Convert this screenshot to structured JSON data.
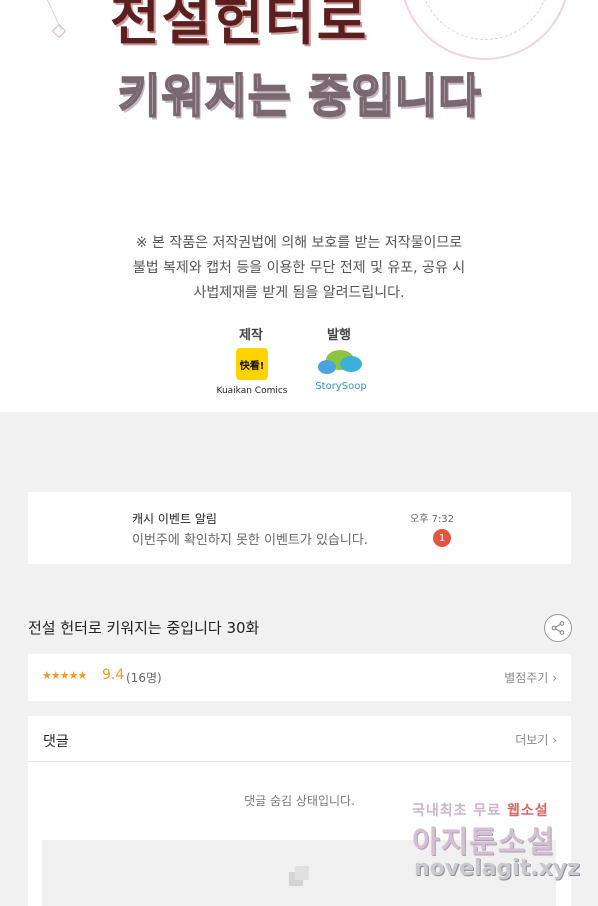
{
  "cover": {
    "title_top": "전설헌터로",
    "title_sub": "키워지는 중입니다"
  },
  "copyright_notice": [
    "※ 본 작품은 저작권법에 의해 보호를 받는 저작물이므로",
    "불법 복제와 캡처 등을 이용한 무단 전제 및 유포, 공유 시",
    "사법제재를 받게 됨을 알려드립니다."
  ],
  "credits": {
    "production_label": "제작",
    "publisher_label": "발행",
    "production_logo_text": "快看!",
    "production_name": "Kuaikan Comics",
    "publisher_name": "StorySoop"
  },
  "event_notice": {
    "title": "캐시 이벤트 알림",
    "message": "이번주에 확인하지 못한 이벤트가 있습니다.",
    "time": "오후 7:32",
    "badge_count": "1"
  },
  "episode": {
    "title": "전설 헌터로 키워지는 중입니다 30화",
    "share_icon": "share-icon"
  },
  "rating": {
    "stars": "★★★★★",
    "score": "9.4",
    "count": "(16명)",
    "rate_link": "별점주기",
    "value": 9.4
  },
  "comments": {
    "title": "댓글",
    "more_link": "더보기",
    "hidden_message": "댓글 숨김 상태입니다."
  },
  "watermark": {
    "line1_a": "국내최초 무료",
    "line1_b": "웹소설",
    "line2": "아지툰소설",
    "line3": "novelagit.xyz"
  },
  "colors": {
    "accent_star": "#f29a1a",
    "badge": "#e4533b",
    "background": "#f1f1f1"
  }
}
